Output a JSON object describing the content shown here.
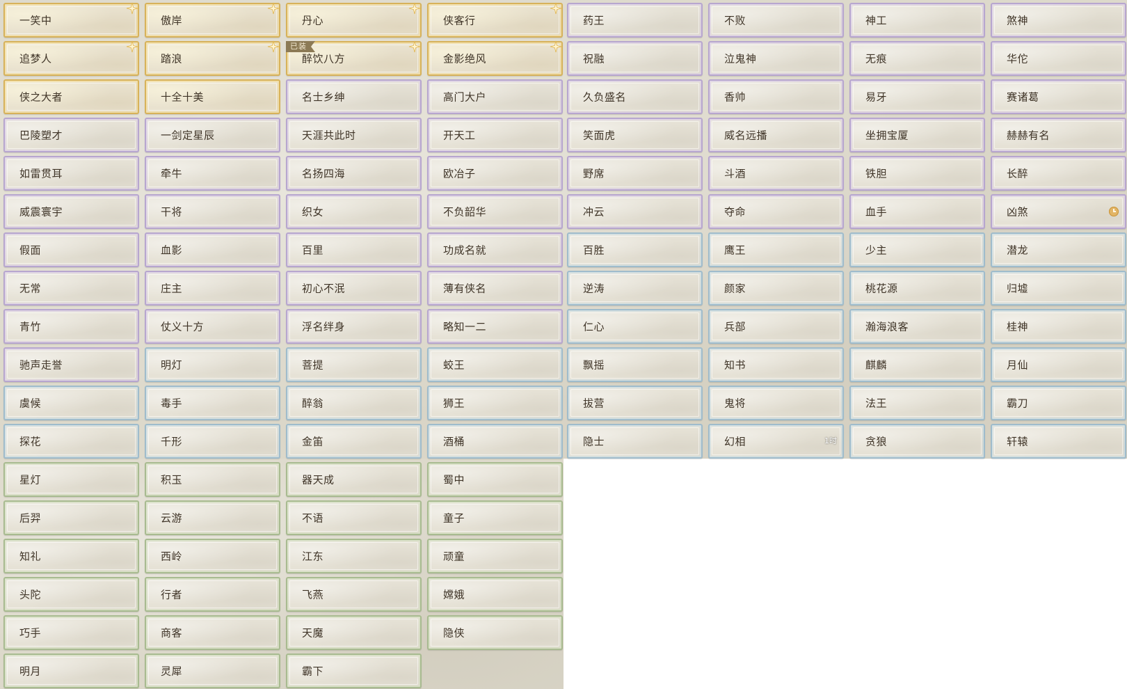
{
  "colors": {
    "gold": "#d7b25a",
    "purple": "#b7a6cf",
    "blue": "#9fbccc",
    "green": "#a8bb90",
    "text": "#3f3427"
  },
  "titles": [
    {
      "label": "一笑中",
      "rarity": "gold",
      "star": true
    },
    {
      "label": "傲岸",
      "rarity": "gold",
      "star": true
    },
    {
      "label": "丹心",
      "rarity": "gold",
      "star": true
    },
    {
      "label": "侠客行",
      "rarity": "gold",
      "star": true
    },
    {
      "label": "药王",
      "rarity": "purple"
    },
    {
      "label": "不败",
      "rarity": "purple"
    },
    {
      "label": "神工",
      "rarity": "purple"
    },
    {
      "label": "煞神",
      "rarity": "purple"
    },
    {
      "label": "追梦人",
      "rarity": "gold",
      "star": true
    },
    {
      "label": "踏浪",
      "rarity": "gold",
      "star": true
    },
    {
      "label": "醉饮八方",
      "rarity": "gold",
      "star": true,
      "equipped": "已装"
    },
    {
      "label": "金影绝风",
      "rarity": "gold",
      "star": true
    },
    {
      "label": "祝融",
      "rarity": "purple"
    },
    {
      "label": "泣鬼神",
      "rarity": "purple"
    },
    {
      "label": "无痕",
      "rarity": "purple"
    },
    {
      "label": "华佗",
      "rarity": "purple"
    },
    {
      "label": "侠之大者",
      "rarity": "gold"
    },
    {
      "label": "十全十美",
      "rarity": "gold"
    },
    {
      "label": "名士乡绅",
      "rarity": "purple"
    },
    {
      "label": "高门大户",
      "rarity": "purple"
    },
    {
      "label": "久负盛名",
      "rarity": "purple"
    },
    {
      "label": "香帅",
      "rarity": "purple"
    },
    {
      "label": "易牙",
      "rarity": "purple"
    },
    {
      "label": "赛诸葛",
      "rarity": "purple"
    },
    {
      "label": "巴陵塑才",
      "rarity": "purple"
    },
    {
      "label": "一剑定星辰",
      "rarity": "purple"
    },
    {
      "label": "天涯共此时",
      "rarity": "purple"
    },
    {
      "label": "开天工",
      "rarity": "purple"
    },
    {
      "label": "笑面虎",
      "rarity": "purple"
    },
    {
      "label": "威名远播",
      "rarity": "purple"
    },
    {
      "label": "坐拥宝厦",
      "rarity": "purple"
    },
    {
      "label": "赫赫有名",
      "rarity": "purple"
    },
    {
      "label": "如雷贯耳",
      "rarity": "purple"
    },
    {
      "label": "牵牛",
      "rarity": "purple"
    },
    {
      "label": "名扬四海",
      "rarity": "purple"
    },
    {
      "label": "欧冶子",
      "rarity": "purple"
    },
    {
      "label": "野席",
      "rarity": "purple"
    },
    {
      "label": "斗酒",
      "rarity": "purple"
    },
    {
      "label": "铁胆",
      "rarity": "purple"
    },
    {
      "label": "长醉",
      "rarity": "purple"
    },
    {
      "label": "威震寰宇",
      "rarity": "purple"
    },
    {
      "label": "干将",
      "rarity": "purple"
    },
    {
      "label": "织女",
      "rarity": "purple"
    },
    {
      "label": "不负韶华",
      "rarity": "purple"
    },
    {
      "label": "冲云",
      "rarity": "purple"
    },
    {
      "label": "夺命",
      "rarity": "purple"
    },
    {
      "label": "血手",
      "rarity": "purple"
    },
    {
      "label": "凶煞",
      "rarity": "purple",
      "clock": true
    },
    {
      "label": "假面",
      "rarity": "purple"
    },
    {
      "label": "血影",
      "rarity": "purple"
    },
    {
      "label": "百里",
      "rarity": "purple"
    },
    {
      "label": "功成名就",
      "rarity": "purple"
    },
    {
      "label": "百胜",
      "rarity": "blue"
    },
    {
      "label": "鹰王",
      "rarity": "blue"
    },
    {
      "label": "少主",
      "rarity": "blue"
    },
    {
      "label": "潜龙",
      "rarity": "blue"
    },
    {
      "label": "无常",
      "rarity": "purple"
    },
    {
      "label": "庄主",
      "rarity": "purple"
    },
    {
      "label": "初心不泯",
      "rarity": "purple"
    },
    {
      "label": "薄有侠名",
      "rarity": "purple"
    },
    {
      "label": "逆涛",
      "rarity": "blue"
    },
    {
      "label": "颜家",
      "rarity": "blue"
    },
    {
      "label": "桃花源",
      "rarity": "blue"
    },
    {
      "label": "归墟",
      "rarity": "blue"
    },
    {
      "label": "青竹",
      "rarity": "purple"
    },
    {
      "label": "仗义十方",
      "rarity": "purple"
    },
    {
      "label": "浮名绊身",
      "rarity": "purple"
    },
    {
      "label": "略知一二",
      "rarity": "purple"
    },
    {
      "label": "仁心",
      "rarity": "blue"
    },
    {
      "label": "兵部",
      "rarity": "blue"
    },
    {
      "label": "瀚海浪客",
      "rarity": "blue"
    },
    {
      "label": "桂神",
      "rarity": "blue"
    },
    {
      "label": "驰声走誉",
      "rarity": "purple"
    },
    {
      "label": "明灯",
      "rarity": "blue"
    },
    {
      "label": "菩提",
      "rarity": "blue"
    },
    {
      "label": "蛟王",
      "rarity": "blue"
    },
    {
      "label": "飘摇",
      "rarity": "blue"
    },
    {
      "label": "知书",
      "rarity": "blue"
    },
    {
      "label": "麒麟",
      "rarity": "blue"
    },
    {
      "label": "月仙",
      "rarity": "blue"
    },
    {
      "label": "虞候",
      "rarity": "blue"
    },
    {
      "label": "毒手",
      "rarity": "blue"
    },
    {
      "label": "醉翁",
      "rarity": "blue"
    },
    {
      "label": "狮王",
      "rarity": "blue"
    },
    {
      "label": "拔营",
      "rarity": "blue"
    },
    {
      "label": "鬼将",
      "rarity": "blue"
    },
    {
      "label": "法王",
      "rarity": "blue"
    },
    {
      "label": "霸刀",
      "rarity": "blue"
    },
    {
      "label": "探花",
      "rarity": "blue"
    },
    {
      "label": "千形",
      "rarity": "blue"
    },
    {
      "label": "金笛",
      "rarity": "blue"
    },
    {
      "label": "酒桶",
      "rarity": "blue"
    },
    {
      "label": "隐士",
      "rarity": "blue"
    },
    {
      "label": "幻相",
      "rarity": "blue",
      "timer": "1时"
    },
    {
      "label": "贪狼",
      "rarity": "blue"
    },
    {
      "label": "轩辕",
      "rarity": "blue"
    },
    {
      "label": "星灯",
      "rarity": "green"
    },
    {
      "label": "积玉",
      "rarity": "green"
    },
    {
      "label": "器天成",
      "rarity": "green"
    },
    {
      "label": "蜀中",
      "rarity": "green"
    },
    {
      "label": "后羿",
      "rarity": "green"
    },
    {
      "label": "云游",
      "rarity": "green"
    },
    {
      "label": "不语",
      "rarity": "green"
    },
    {
      "label": "童子",
      "rarity": "green"
    },
    {
      "label": "知礼",
      "rarity": "green"
    },
    {
      "label": "西岭",
      "rarity": "green"
    },
    {
      "label": "江东",
      "rarity": "green"
    },
    {
      "label": "顽童",
      "rarity": "green"
    },
    {
      "label": "头陀",
      "rarity": "green"
    },
    {
      "label": "行者",
      "rarity": "green"
    },
    {
      "label": "飞燕",
      "rarity": "green"
    },
    {
      "label": "嫦娥",
      "rarity": "green"
    },
    {
      "label": "巧手",
      "rarity": "green"
    },
    {
      "label": "商客",
      "rarity": "green"
    },
    {
      "label": "天魔",
      "rarity": "green"
    },
    {
      "label": "隐侠",
      "rarity": "green"
    },
    {
      "label": "明月",
      "rarity": "green"
    },
    {
      "label": "灵犀",
      "rarity": "green"
    },
    {
      "label": "霸下",
      "rarity": "green"
    }
  ]
}
